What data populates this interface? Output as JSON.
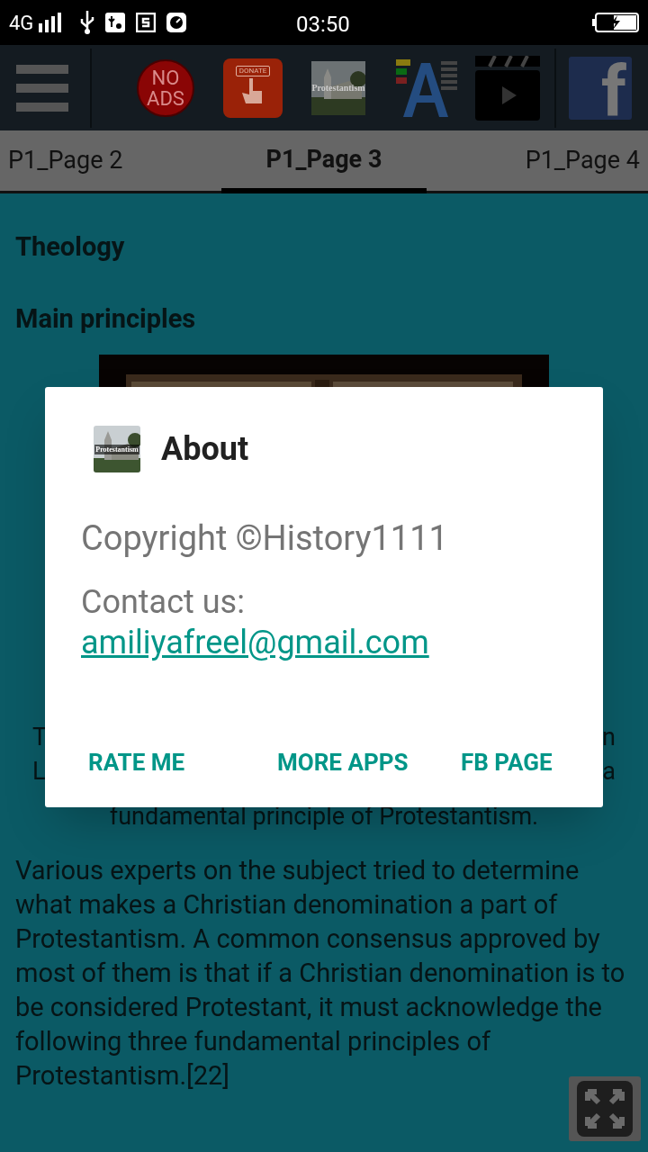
{
  "status_bar": {
    "network": "4G",
    "time": "03:50"
  },
  "toolbar": {
    "no_ads": [
      "NO",
      "ADS"
    ],
    "donate": "DONATE",
    "app_icon_label": "Protestantism",
    "facebook": "f"
  },
  "tabs": [
    {
      "label": "P1_Page 2",
      "selected": false
    },
    {
      "label": "P1_Page 3",
      "selected": true
    },
    {
      "label": "P1_Page 4",
      "selected": false
    }
  ],
  "content": {
    "headings": [
      "Theology",
      "Main principles"
    ],
    "image": {
      "kind": "picture"
    },
    "hidden_lines": [
      {
        "left": "T",
        "right": "n"
      },
      {
        "left": "L",
        "right": "a"
      }
    ],
    "line_tail": "fundamental principle of Protestantism.",
    "paragraph": "Various experts on the subject tried to determine what makes a Christian denomination a part of Protestantism. A common consensus approved by most of them is that if a Christian denomination is to be considered Protestant, it must acknowledge the following three fundamental principles of Protestantism.[22]"
  },
  "dialog": {
    "icon_label": "Protestantism",
    "title": "About",
    "copyright": "Copyright ©History1111",
    "contact_label": "Contact us:",
    "email": "amiliyafreel@gmail.com",
    "buttons": [
      "RATE ME",
      "MORE APPS",
      "FB PAGE"
    ]
  }
}
